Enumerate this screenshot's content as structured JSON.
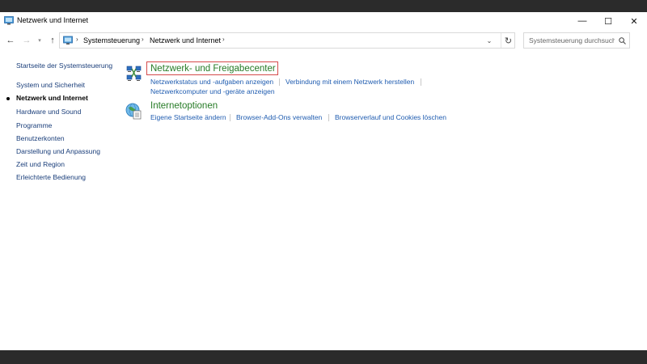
{
  "window": {
    "title": "Netzwerk und Internet",
    "controls": {
      "minimize": "—",
      "maximize": "☐",
      "close": "✕"
    }
  },
  "address": {
    "crumbs": [
      "Systemsteuerung",
      "Netzwerk und Internet"
    ],
    "search_placeholder": "Systemsteuerung durchsuchen"
  },
  "sidebar": {
    "home": "Startseite der Systemsteuerung",
    "items": [
      {
        "label": "System und Sicherheit",
        "active": false
      },
      {
        "label": "Netzwerk und Internet",
        "active": true
      },
      {
        "label": "Hardware und Sound",
        "active": false
      },
      {
        "label": "Programme",
        "active": false
      },
      {
        "label": "Benutzerkonten",
        "active": false
      },
      {
        "label": "Darstellung und Anpassung",
        "active": false
      },
      {
        "label": "Zeit und Region",
        "active": false
      },
      {
        "label": "Erleichterte Bedienung",
        "active": false
      }
    ]
  },
  "categories": [
    {
      "heading": "Netzwerk- und Freigabecenter",
      "icon": "network-icon",
      "tasks": [
        "Netzwerkstatus und -aufgaben anzeigen",
        "Verbindung mit einem Netzwerk herstellen",
        "Netzwerkcomputer und -geräte anzeigen"
      ]
    },
    {
      "heading": "Internetoptionen",
      "icon": "globe-icon",
      "tasks": [
        "Eigene Startseite ändern",
        "Browser-Add-Ons verwalten",
        "Browserverlauf und Cookies löschen"
      ]
    }
  ],
  "colors": {
    "heading": "#267b26",
    "link": "#1f5cb0",
    "highlight_box": "#d54b4b"
  }
}
